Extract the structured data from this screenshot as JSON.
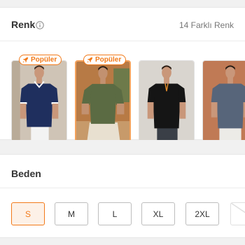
{
  "color_section": {
    "title": "Renk",
    "count_label": "14 Farklı Renk",
    "swatches": [
      {
        "shirt_color": "#1f2f5e",
        "bg_color": "#cfc4b6",
        "badge": "Popüler",
        "selected": false
      },
      {
        "shirt_color": "#5b6b43",
        "bg_color": "#b77a45",
        "badge": "Popüler",
        "selected": true
      },
      {
        "shirt_color": "#151515",
        "bg_color": "#d9d5cf",
        "badge": "",
        "selected": false
      },
      {
        "shirt_color": "#57657a",
        "bg_color": "#c07a55",
        "badge": "",
        "selected": false
      }
    ]
  },
  "size_section": {
    "title": "Beden",
    "sizes": [
      {
        "label": "S",
        "selected": true
      },
      {
        "label": "M",
        "selected": false
      },
      {
        "label": "L",
        "selected": false
      },
      {
        "label": "XL",
        "selected": false
      },
      {
        "label": "2XL",
        "selected": false
      },
      {
        "label": "",
        "selected": false
      }
    ]
  },
  "colors": {
    "accent": "#f27a1a",
    "selected_swatch_border": "#f4a25c"
  }
}
